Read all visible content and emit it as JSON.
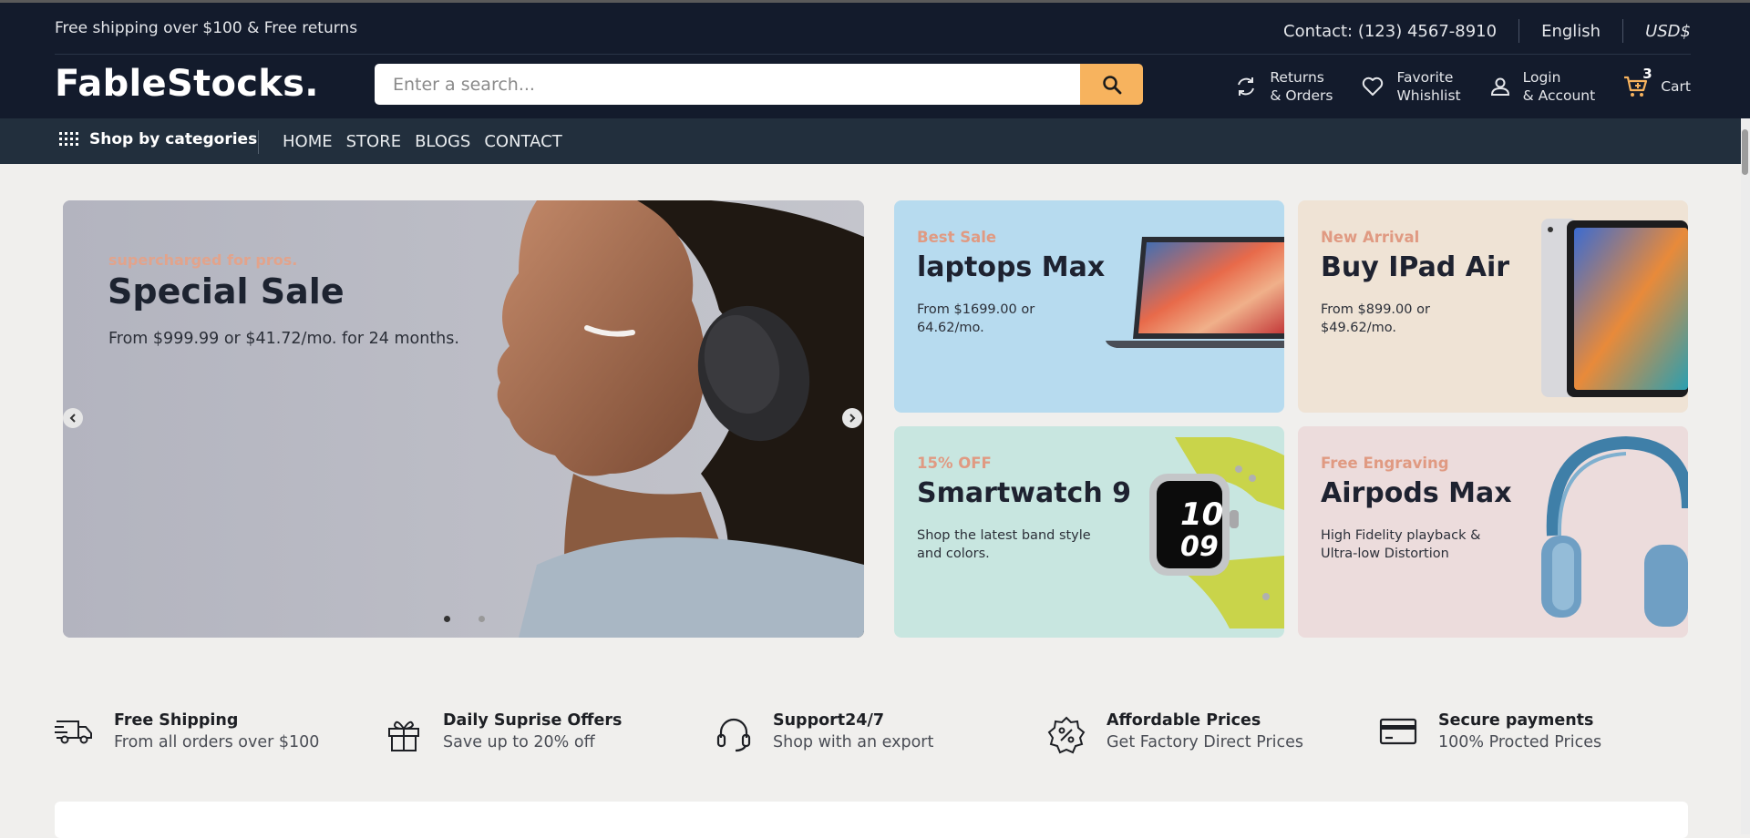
{
  "topbar": {
    "promo": "Free shipping over $100 & Free returns",
    "contact": "Contact: (123) 4567-8910",
    "language": "English",
    "currency": "USD$"
  },
  "header": {
    "logo": "FableStocks.",
    "search_placeholder": "Enter a search...",
    "links": [
      {
        "line1": "Returns",
        "line2": "& Orders",
        "icon": "refresh-icon"
      },
      {
        "line1": "Favorite",
        "line2": "Whishlist",
        "icon": "heart-icon"
      },
      {
        "line1": "Login",
        "line2": "& Account",
        "icon": "user-icon"
      }
    ],
    "cart": {
      "count": "3",
      "label": "Cart",
      "icon": "cart-icon"
    }
  },
  "nav": {
    "categories_label": "Shop by categories",
    "links": [
      "HOME",
      "STORE",
      "BLOGS",
      "CONTACT"
    ]
  },
  "hero": {
    "tag": "supercharged for pros.",
    "title": "Special Sale",
    "desc": "From $999.99 or $41.72/mo. for 24 months.",
    "slides": 2,
    "active_slide": 1
  },
  "cards": [
    {
      "tag": "Best Sale",
      "title": "laptops Max",
      "desc": "From $1699.00 or 64.62/mo."
    },
    {
      "tag": "New Arrival",
      "title": "Buy IPad Air",
      "desc": "From $899.00 or $49.62/mo."
    },
    {
      "tag": "15% OFF",
      "title": "Smartwatch 9",
      "desc": "Shop the latest band style and colors."
    },
    {
      "tag": "Free Engraving",
      "title": "Airpods Max",
      "desc": "High Fidelity playback & Ultra-low Distortion"
    }
  ],
  "features": [
    {
      "title": "Free Shipping",
      "sub": "From all orders over $100",
      "icon": "truck-icon"
    },
    {
      "title": "Daily Suprise Offers",
      "sub": "Save up to 20% off",
      "icon": "gift-icon"
    },
    {
      "title": "Support24/7",
      "sub": "Shop with an export",
      "icon": "headset-icon"
    },
    {
      "title": "Affordable Prices",
      "sub": "Get Factory Direct Prices",
      "icon": "percent-badge-icon"
    },
    {
      "title": "Secure payments",
      "sub": "100% Procted Prices",
      "icon": "credit-card-icon"
    }
  ],
  "colors": {
    "header_bg": "#131b2c",
    "nav_bg": "#222f3d",
    "accent": "#f7b35e",
    "page_bg": "#f0efed",
    "card_laptop": "#b7dbef",
    "card_ipad": "#efe3d5",
    "card_watch": "#c8e6e0",
    "card_airpods": "#ecdcdc"
  }
}
